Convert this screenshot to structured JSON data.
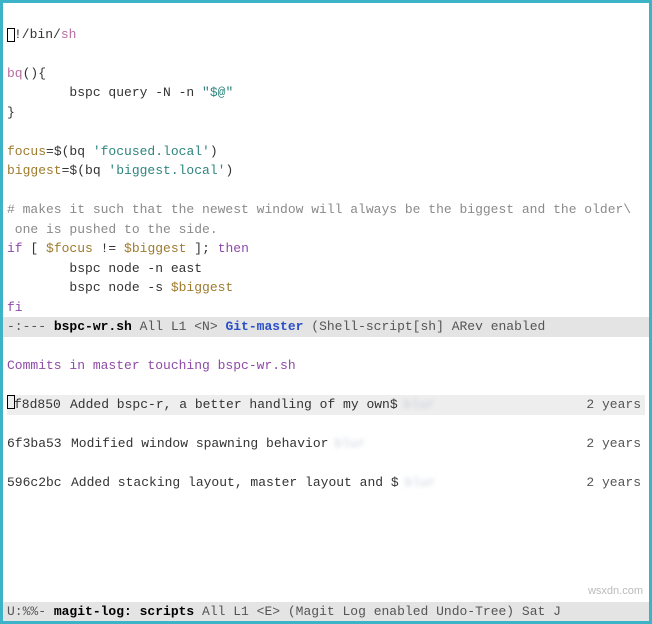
{
  "editor": {
    "shebang_prefix": "!/bin/",
    "shebang_sh": "sh",
    "fn_name": "bq",
    "fn_open": "(){",
    "query_cmd": "        bspc query -N -n ",
    "query_arg": "\"$@\"",
    "brace_close": "}",
    "focus_var": "focus",
    "focus_assign": "=$(bq ",
    "focus_arg": "'focused.local'",
    "focus_close": ")",
    "biggest_var": "biggest",
    "biggest_assign": "=$(bq ",
    "biggest_arg": "'biggest.local'",
    "biggest_close": ")",
    "comment1": "# makes it such that the newest window will always be the biggest and the older\\",
    "comment2": " one is pushed to the side.",
    "if_kw": "if",
    "if_open": " [ ",
    "if_focus": "$focus",
    "if_ne": " != ",
    "if_biggest": "$biggest",
    "if_close": " ]; ",
    "then_kw": "then",
    "body1": "        bspc node -n east",
    "body2a": "        bspc node -s ",
    "body2b": "$biggest",
    "fi_kw": "fi"
  },
  "modeline1": {
    "left": " -:--- ",
    "filename": " bspc-wr.sh",
    "pos": "    All L1   <N>  ",
    "vc": "Git-master",
    "mode": "  (Shell-script[sh] ARev enabled"
  },
  "log": {
    "header": "Commits in master touching bspc-wr.sh",
    "commits": [
      {
        "hash": "f8d850",
        "msg": "Added bspc-r, a better handling of my own$",
        "author": "blur",
        "age": "2 years"
      },
      {
        "hash": "6f3ba53",
        "msg": "Modified window spawning behavior",
        "author": "blur",
        "age": "2 years"
      },
      {
        "hash": "596c2bc",
        "msg": "Added stacking layout, master layout and $",
        "author": "blur",
        "age": "2 years"
      }
    ]
  },
  "modeline2": {
    "left": " U:%%- ",
    "filename": " magit-log: scripts",
    "pos": "  All L1   <E>  ",
    "mode": " (Magit Log enabled Undo-Tree)  Sat J"
  },
  "watermark": "wsxdn.com"
}
